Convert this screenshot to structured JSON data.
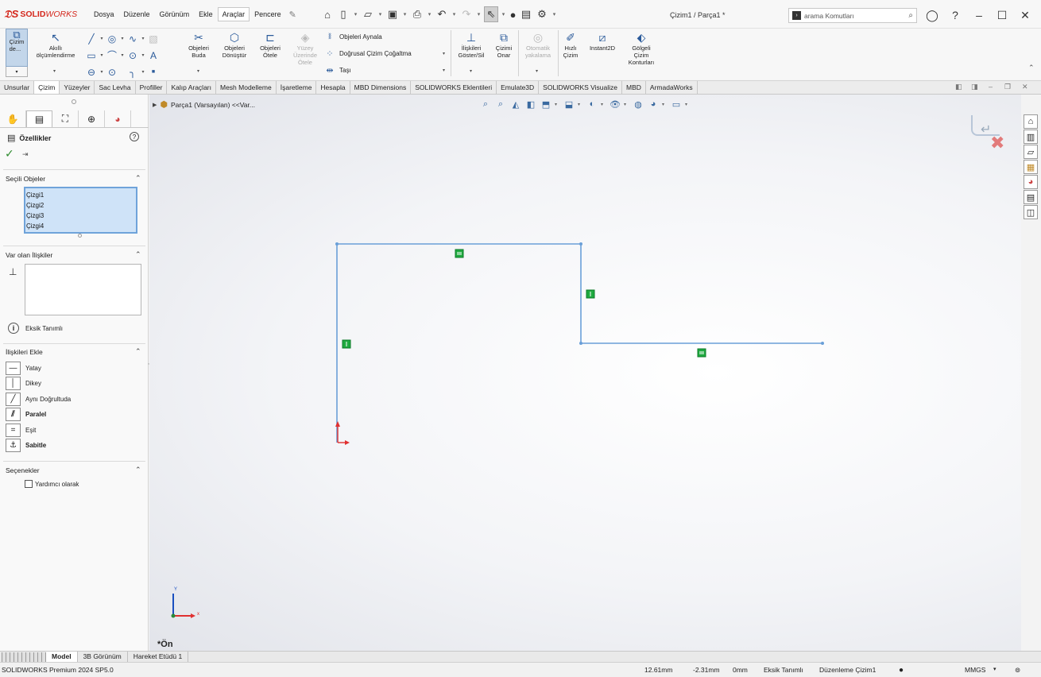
{
  "app": {
    "brand": "SOLIDWORKS",
    "document_title": "Çizim1 / Parça1 *",
    "search_placeholder": "arama Komutları"
  },
  "menu": [
    "Dosya",
    "Düzenle",
    "Görünüm",
    "Ekle",
    "Araçlar",
    "Pencere"
  ],
  "command_manager": {
    "sketch": "Çizim\nde...",
    "smart_dim": "Akıllı\nölçümlendirme",
    "trim": "Objeleri\nBuda",
    "convert": "Objeleri\nDönüştür",
    "offset": "Objeleri\nÖtele",
    "surface_offset": "Yüzey\nÜzerinde\nÖtele",
    "mirror": "Objeleri Aynala",
    "linear_pattern": "Doğrusal Çizim Çoğaltma",
    "move": "Taşı",
    "relations": "İlişkileri\nGöster/Sil",
    "repair": "Çizimi\nOnar",
    "snap": "Otomatik\nyakalama",
    "rapid": "Hızlı\nÇizim",
    "instant2d": "Instant2D",
    "shaded": "Gölgeli\nÇizim\nKonturları"
  },
  "tabs": [
    "Unsurlar",
    "Çizim",
    "Yüzeyler",
    "Sac Levha",
    "Profiller",
    "Kalıp Araçları",
    "Mesh Modelleme",
    "İşaretleme",
    "Hesapla",
    "MBD Dimensions",
    "SOLIDWORKS Eklentileri",
    "Emulate3D",
    "SOLIDWORKS Visualize",
    "MBD",
    "ArmadaWorks"
  ],
  "active_tab": "Çizim",
  "property_manager": {
    "title": "Özellikler",
    "selected_section": "Seçili Objeler",
    "selected_items": [
      "Çizgi1",
      "Çizgi2",
      "Çizgi3",
      "Çizgi4"
    ],
    "existing_section": "Var olan İlişkiler",
    "status": "Eksik Tanımlı",
    "add_section": "İlişkileri Ekle",
    "relations": [
      {
        "label": "Yatay",
        "bold": false
      },
      {
        "label": "Dikey",
        "bold": false
      },
      {
        "label": "Aynı Doğrultuda",
        "bold": false
      },
      {
        "label": "Paralel",
        "bold": true
      },
      {
        "label": "Eşit",
        "bold": false
      },
      {
        "label": "Sabitle",
        "bold": true
      }
    ],
    "options_section": "Seçenekler",
    "construction": "Yardımcı olarak"
  },
  "viewport": {
    "tree_label": "Parça1 (Varsayılan) <<Var...",
    "view_name": "*Ön",
    "axis_x": "x",
    "axis_y": "Y"
  },
  "bottom_tabs": [
    "Model",
    "3B Görünüm",
    "Hareket Etüdü 1"
  ],
  "status_bar": {
    "product": "SOLIDWORKS Premium 2024 SP5.0",
    "x": "12.61mm",
    "y": "-2.31mm",
    "z": "0mm",
    "state": "Eksik Tanımlı",
    "mode": "Düzenleme Çizim1",
    "units": "MMGS"
  },
  "colors": {
    "sketch_line": "#6a9fd8",
    "relation_badge": "#1faa3f",
    "brand_red": "#d4271c",
    "selection_fill": "#cfe3f8"
  }
}
